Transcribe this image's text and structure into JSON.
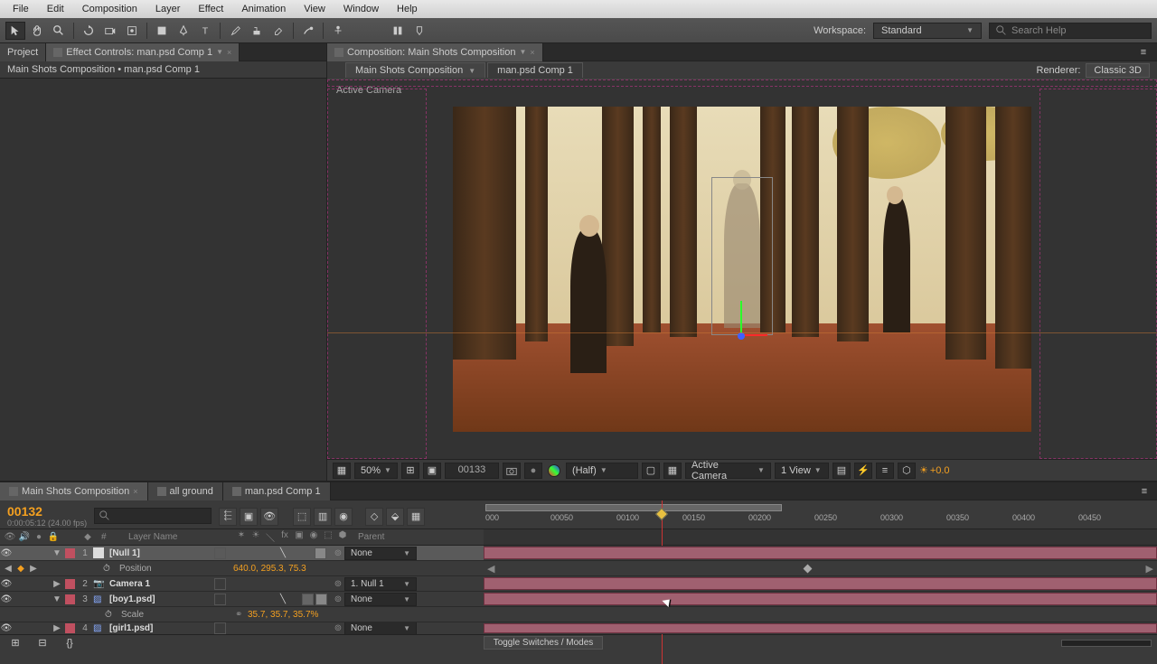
{
  "menu": [
    "File",
    "Edit",
    "Composition",
    "Layer",
    "Effect",
    "Animation",
    "View",
    "Window",
    "Help"
  ],
  "workspace": {
    "label": "Workspace:",
    "value": "Standard"
  },
  "search_placeholder": "Search Help",
  "project_panel": {
    "tab_project": "Project",
    "tab_fx": "Effect Controls: man.psd Comp 1",
    "subhead": "Main Shots Composition • man.psd Comp 1"
  },
  "comp_panel": {
    "tab": "Composition: Main Shots Composition",
    "subtab1": "Main Shots Composition",
    "subtab2": "man.psd Comp 1",
    "renderer_label": "Renderer:",
    "renderer_value": "Classic 3D",
    "active_camera": "Active Camera"
  },
  "viewport_bar": {
    "zoom": "50%",
    "timecode": "00133",
    "resolution": "(Half)",
    "camera": "Active Camera",
    "views": "1 View",
    "exposure": "+0.0"
  },
  "timeline": {
    "tabs": [
      "Main Shots Composition",
      "all ground",
      "man.psd Comp 1"
    ],
    "timecode": "00132",
    "fps": "0:00:05:12 (24.00 fps)",
    "col_num": "#",
    "col_name": "Layer Name",
    "col_parent": "Parent",
    "ruler": [
      "000",
      "00050",
      "00100",
      "00150",
      "00200",
      "00250",
      "00300",
      "00350",
      "00400",
      "00450"
    ],
    "toggle": "Toggle Switches / Modes",
    "layers": [
      {
        "num": "1",
        "name": "[Null 1]",
        "color": "#c05060",
        "parent": "None",
        "expanded": true,
        "props": [
          {
            "name": "Position",
            "value": "640.0, 295.3, 75.3"
          }
        ]
      },
      {
        "num": "2",
        "name": "Camera 1",
        "color": "#c05060",
        "parent": "1. Null 1",
        "icon": "camera"
      },
      {
        "num": "3",
        "name": "[boy1.psd]",
        "color": "#c05060",
        "parent": "None",
        "icon": "layer",
        "expanded": true,
        "props": [
          {
            "name": "Scale",
            "value": "35.7, 35.7, 35.7%"
          }
        ]
      },
      {
        "num": "4",
        "name": "[girl1.psd]",
        "color": "#c05060",
        "parent": "None",
        "icon": "layer"
      }
    ]
  }
}
